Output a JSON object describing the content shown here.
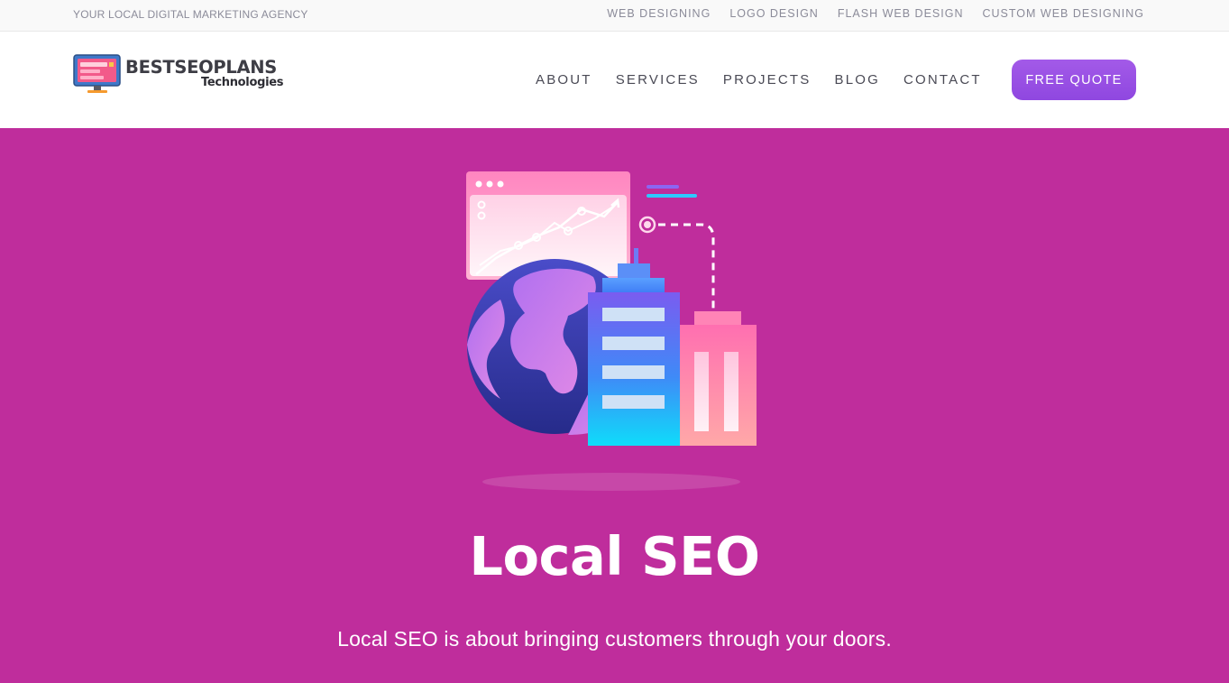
{
  "topbar": {
    "tagline": "YOUR LOCAL DIGITAL MARKETING AGENCY",
    "links": [
      "WEB DESIGNING",
      "LOGO DESIGN",
      "FLASH WEB DESIGN",
      "CUSTOM WEB DESIGNING"
    ]
  },
  "header": {
    "logo": {
      "line1": "BESTSEOPLANS",
      "line2": "Technologies",
      "icon": "monitor-icon"
    },
    "nav": [
      "ABOUT",
      "SERVICES",
      "PROJECTS",
      "BLOG",
      "CONTACT"
    ],
    "cta_label": "FREE QUOTE"
  },
  "hero": {
    "title": "Local SEO",
    "subtitle": "Local SEO is about bringing customers through your doors.",
    "illustration": "local-seo-illustration"
  },
  "colors": {
    "hero_bg": "#bf2d9c",
    "cta_bg": "#9b52e6",
    "nav_text": "#4a4a55",
    "topbar_text": "#8b8b99"
  }
}
